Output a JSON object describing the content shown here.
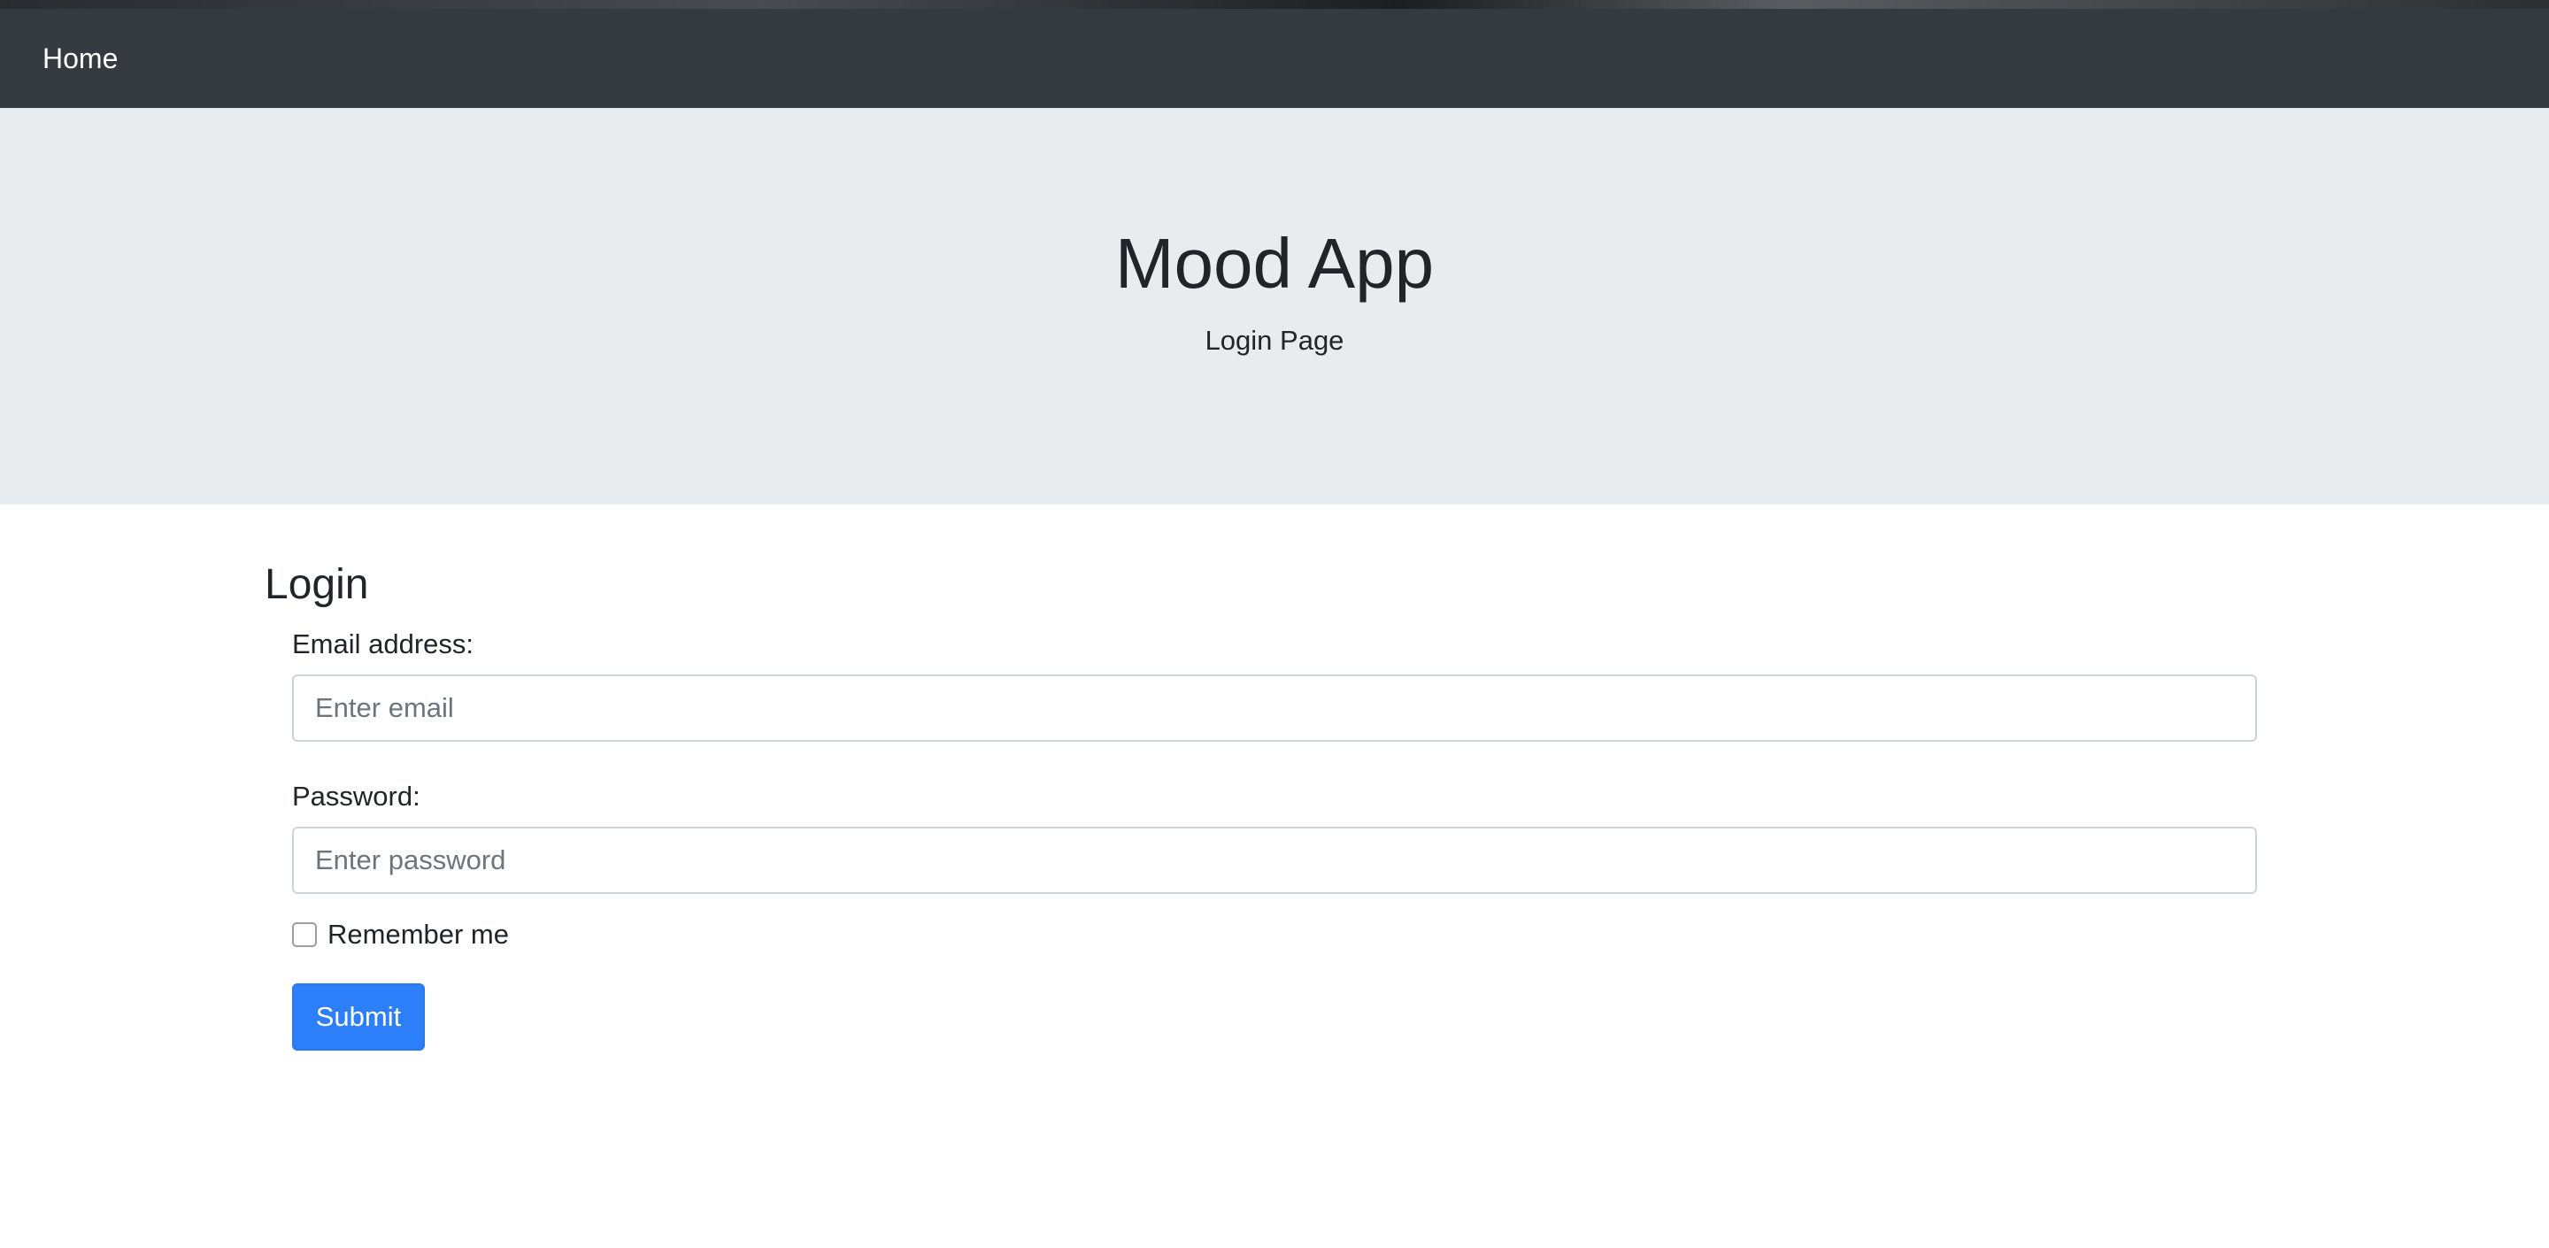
{
  "navbar": {
    "home_label": "Home"
  },
  "jumbotron": {
    "title": "Mood App",
    "subtitle": "Login Page"
  },
  "login": {
    "title": "Login",
    "email_label": "Email address:",
    "email_value": "",
    "email_placeholder": "Enter email",
    "password_label": "Password:",
    "password_value": "",
    "password_placeholder": "Enter password",
    "remember_label": "Remember me",
    "remember_checked": false,
    "submit_label": "Submit"
  },
  "colors": {
    "navbar_bg": "#343a40",
    "jumbotron_bg": "#e9ecef",
    "primary": "#2d7ff9"
  }
}
